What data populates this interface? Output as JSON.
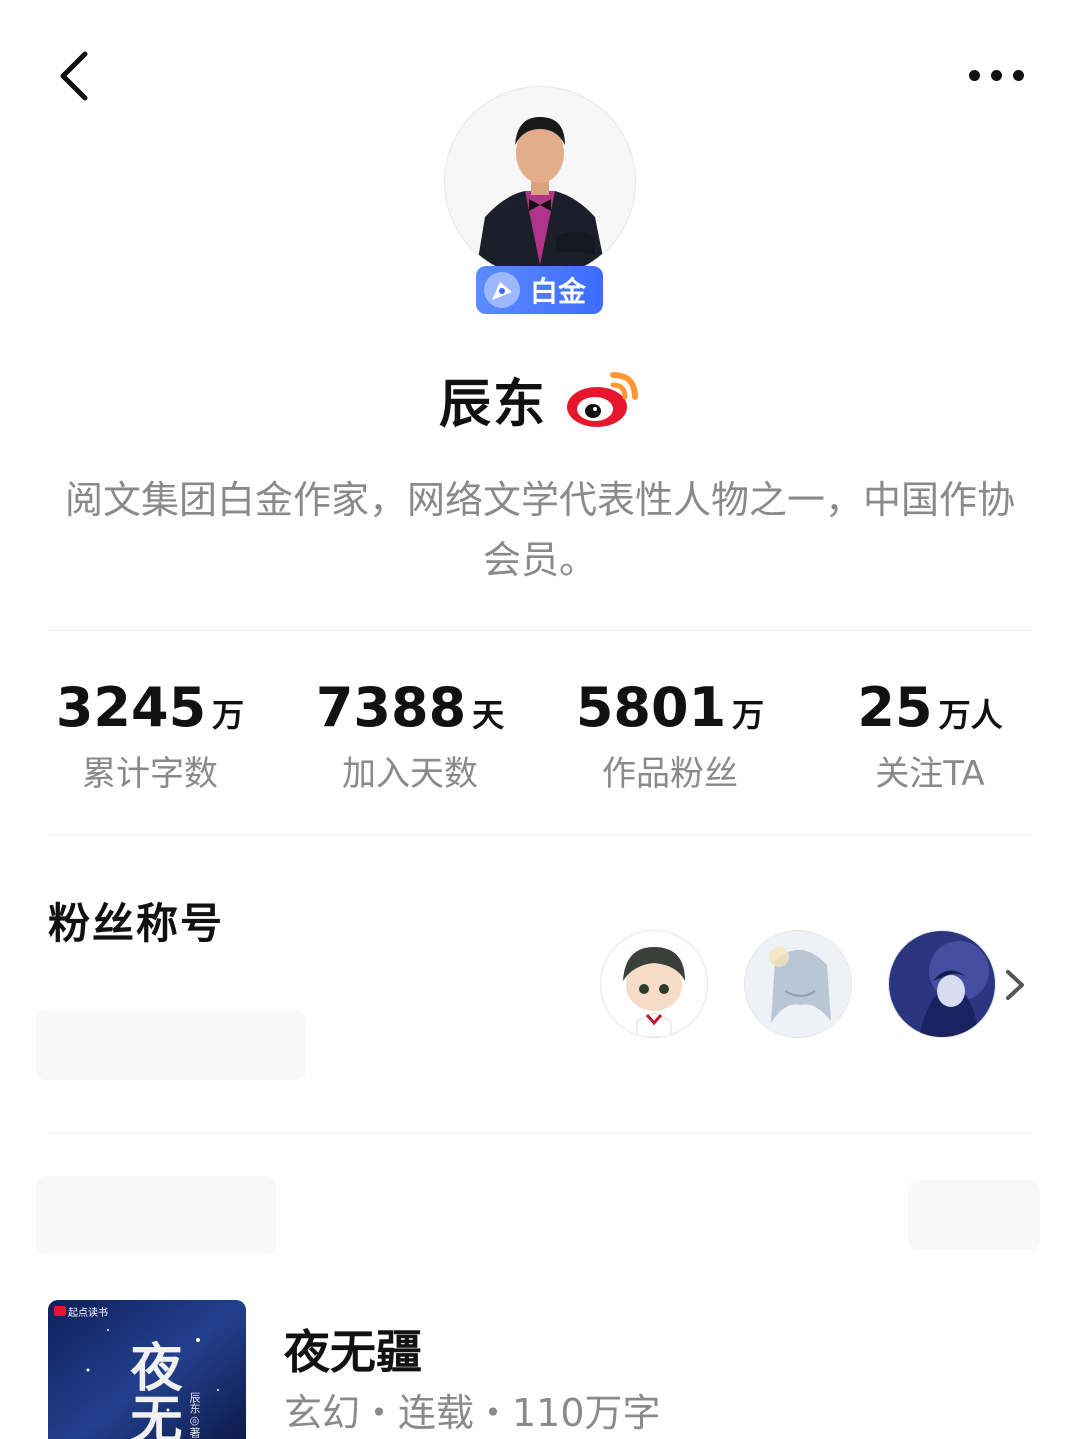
{
  "header": {
    "back_icon": "chevron-left-icon",
    "more_icon": "more-dots-icon"
  },
  "profile": {
    "badge_label": "白金",
    "name": "辰东",
    "weibo_icon": "weibo-icon",
    "bio": "阅文集团白金作家，网络文学代表性人物之一，中国作协会员。"
  },
  "stats": [
    {
      "value": "3245",
      "unit": "万",
      "label": "累计字数"
    },
    {
      "value": "7388",
      "unit": "天",
      "label": "加入天数"
    },
    {
      "value": "5801",
      "unit": "万",
      "label": "作品粉丝"
    },
    {
      "value": "25",
      "unit": "万人",
      "label": "关注TA"
    }
  ],
  "fan_titles": {
    "title": "粉丝称号"
  },
  "book": {
    "title": "夜无疆",
    "meta": "玄幻・连载・110万字",
    "cover_publisher": "起点读书",
    "cover_title": "夜无",
    "cover_author": "辰东◎著"
  },
  "colors": {
    "accent_blue": "#3d6bff",
    "weibo_red": "#e6162d",
    "weibo_orange": "#ff9933",
    "muted_text": "#8a8a8a"
  }
}
